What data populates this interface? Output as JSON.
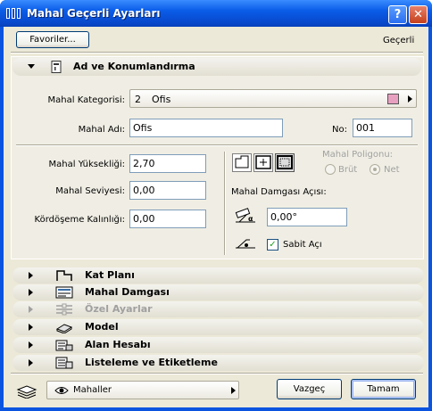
{
  "window": {
    "title": "Mahal Geçerli Ayarları",
    "help_label": "?",
    "close_label": "✕"
  },
  "toolbar": {
    "favorites_label": "Favoriler...",
    "current_label": "Geçerli"
  },
  "section_main": {
    "label": "Ad ve Konumlandırma",
    "category_label": "Mahal Kategorisi:",
    "category_number": "2",
    "category_value": "Ofis",
    "category_color": "#e8a0c0",
    "name_label": "Mahal Adı:",
    "name_value": "Ofis",
    "no_label": "No:",
    "no_value": "001",
    "height_label": "Mahal Yüksekliği:",
    "height_value": "2,70",
    "level_label": "Mahal Seviyesi:",
    "level_value": "0,00",
    "floor_thickness_label": "Kördöşeme Kalınlığı:",
    "floor_thickness_value": "0,00",
    "polygon_label": "Mahal Poligonu:",
    "polygon_options": [
      "Brüt",
      "Net"
    ],
    "polygon_selected": "Net",
    "stamp_angle_label": "Mahal Damgası Açısı:",
    "stamp_angle_value": "0,00°",
    "fixed_angle_label": "Sabit Açı",
    "fixed_angle_checked": true
  },
  "sections": [
    {
      "label": "Kat Planı",
      "icon": "floor-plan-icon",
      "enabled": true
    },
    {
      "label": "Mahal Damgası",
      "icon": "zone-stamp-icon",
      "enabled": true
    },
    {
      "label": "Özel Ayarlar",
      "icon": "custom-settings-icon",
      "enabled": false
    },
    {
      "label": "Model",
      "icon": "model-icon",
      "enabled": true
    },
    {
      "label": "Alan Hesabı",
      "icon": "area-calculation-icon",
      "enabled": true
    },
    {
      "label": "Listeleme ve Etiketleme",
      "icon": "listing-labeling-icon",
      "enabled": true
    }
  ],
  "footer": {
    "layer_value": "Mahaller",
    "cancel_label": "Vazgeç",
    "ok_label": "Tamam"
  }
}
